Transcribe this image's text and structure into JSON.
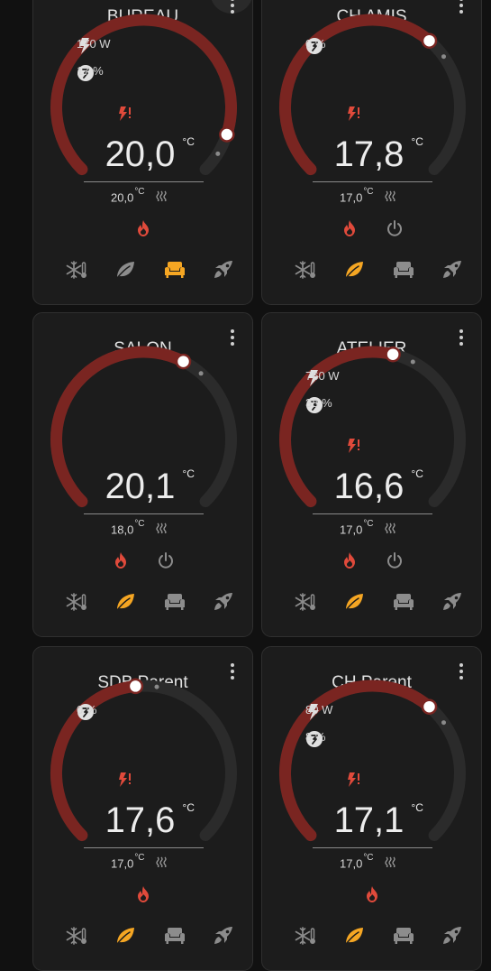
{
  "colors": {
    "page_bg": "#111111",
    "card_bg": "#1c1c1c",
    "arc_active": "#7a2521",
    "arc_inactive": "#2b2b2b",
    "accent_heat": "#e04a3b",
    "accent_orange": "#f5a623",
    "icon_gray": "#8c8c8c"
  },
  "units": {
    "temp": "°C"
  },
  "cards": [
    {
      "id": "bureau",
      "title": "BUREAU",
      "power": "170 W",
      "percent": "17 %",
      "current": "20,0",
      "target": "20,0",
      "setpoint_fraction": 0.9,
      "heat_demand": true,
      "power_button": false,
      "active_preset": "comfort",
      "presets": [
        "frost",
        "eco",
        "comfort",
        "boost"
      ]
    },
    {
      "id": "ch-amis",
      "title": "CH AMIS",
      "power": null,
      "percent": "0 %",
      "current": "17,8",
      "target": "17,0",
      "setpoint_fraction": 0.65,
      "heat_demand": true,
      "power_button": true,
      "active_preset": "eco",
      "presets": [
        "frost",
        "eco",
        "comfort",
        "boost"
      ]
    },
    {
      "id": "salon",
      "title": "SALON",
      "power": null,
      "percent": null,
      "current": "20,1",
      "target": "18,0",
      "setpoint_fraction": 0.6,
      "heat_demand": false,
      "power_button": true,
      "active_preset": "eco",
      "presets": [
        "frost",
        "eco",
        "comfort",
        "boost"
      ]
    },
    {
      "id": "atelier",
      "title": "ATELIER",
      "power": "760 W",
      "percent": "38 %",
      "current": "16,6",
      "target": "17,0",
      "setpoint_fraction": 0.55,
      "heat_demand": true,
      "power_button": true,
      "active_preset": "eco",
      "presets": [
        "frost",
        "eco",
        "comfort",
        "boost"
      ]
    },
    {
      "id": "sdb-parent",
      "title": "SDB Parent",
      "power": null,
      "percent": "0 %",
      "current": "17,6",
      "target": "17,0",
      "setpoint_fraction": 0.48,
      "heat_demand": true,
      "power_button": false,
      "active_preset": "eco",
      "presets": [
        "frost",
        "eco",
        "comfort",
        "boost"
      ]
    },
    {
      "id": "ch-parent",
      "title": "CH Parent",
      "power": "80 W",
      "percent": "8 %",
      "current": "17,1",
      "target": "17,0",
      "setpoint_fraction": 0.65,
      "heat_demand": true,
      "power_button": false,
      "active_preset": "eco",
      "presets": [
        "frost",
        "eco",
        "comfort",
        "boost"
      ]
    }
  ]
}
